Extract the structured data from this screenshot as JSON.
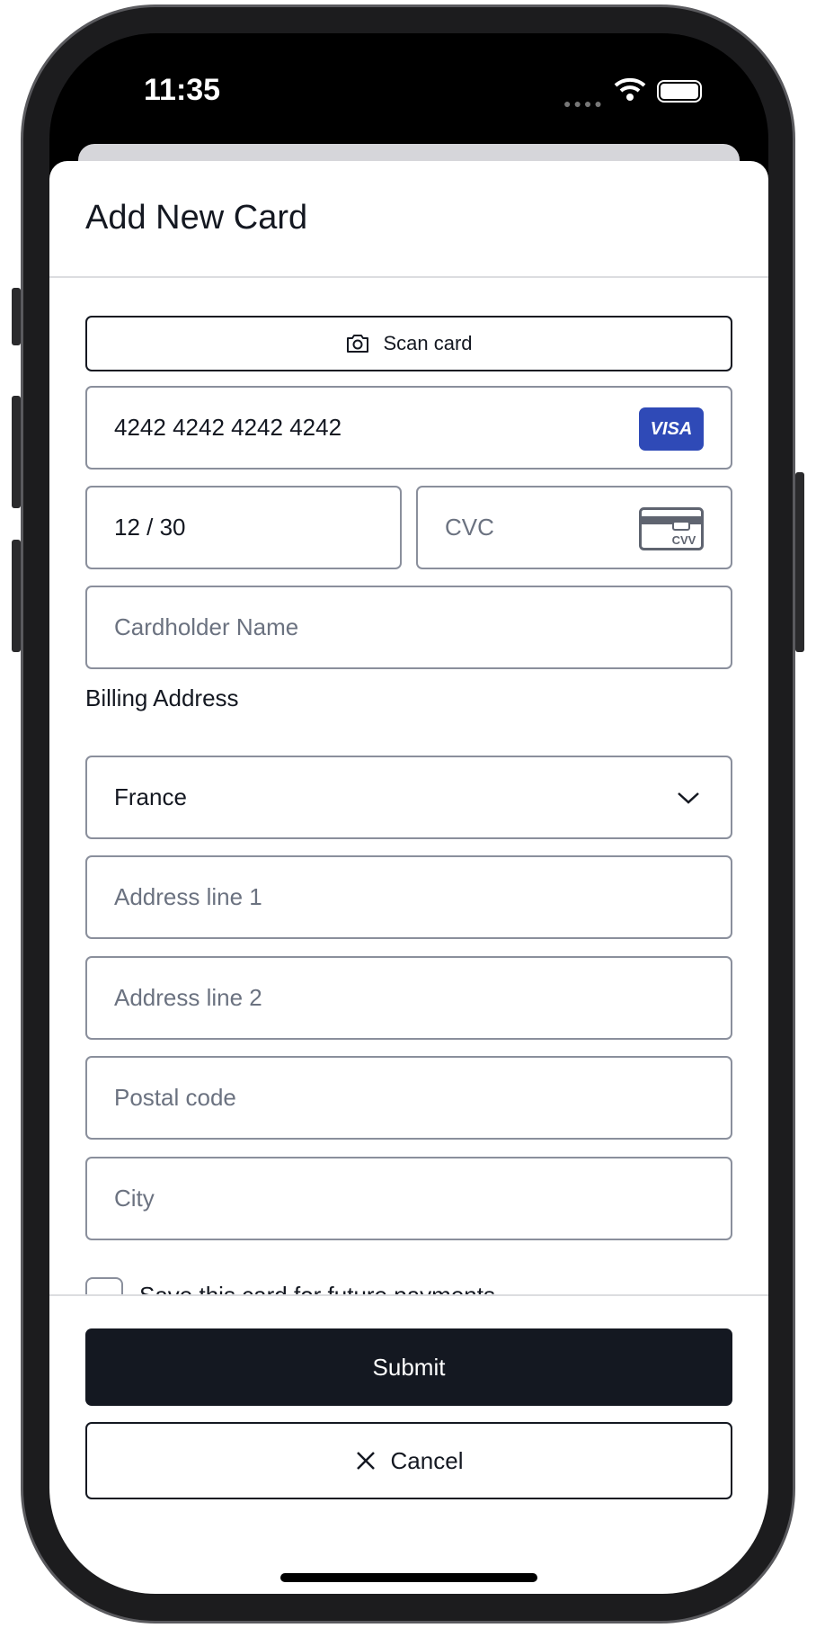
{
  "status_bar": {
    "time": "11:35"
  },
  "sheet": {
    "title": "Add New Card"
  },
  "form": {
    "scan_label": "Scan card",
    "card_number": "4242 4242 4242 4242",
    "card_brand": "VISA",
    "expiry": "12 / 30",
    "cvc_placeholder": "CVC",
    "cvv_icon_text": "CVV",
    "cardholder_placeholder": "Cardholder Name",
    "billing_label": "Billing Address",
    "country": "France",
    "address1_placeholder": "Address line 1",
    "address2_placeholder": "Address line 2",
    "postal_placeholder": "Postal code",
    "city_placeholder": "City",
    "save_card_label": "Save this card for future payments"
  },
  "footer": {
    "submit_label": "Submit",
    "cancel_label": "Cancel"
  },
  "colors": {
    "primary": "#141821",
    "visa": "#2f4ab7",
    "border": "#8a8f9c"
  }
}
